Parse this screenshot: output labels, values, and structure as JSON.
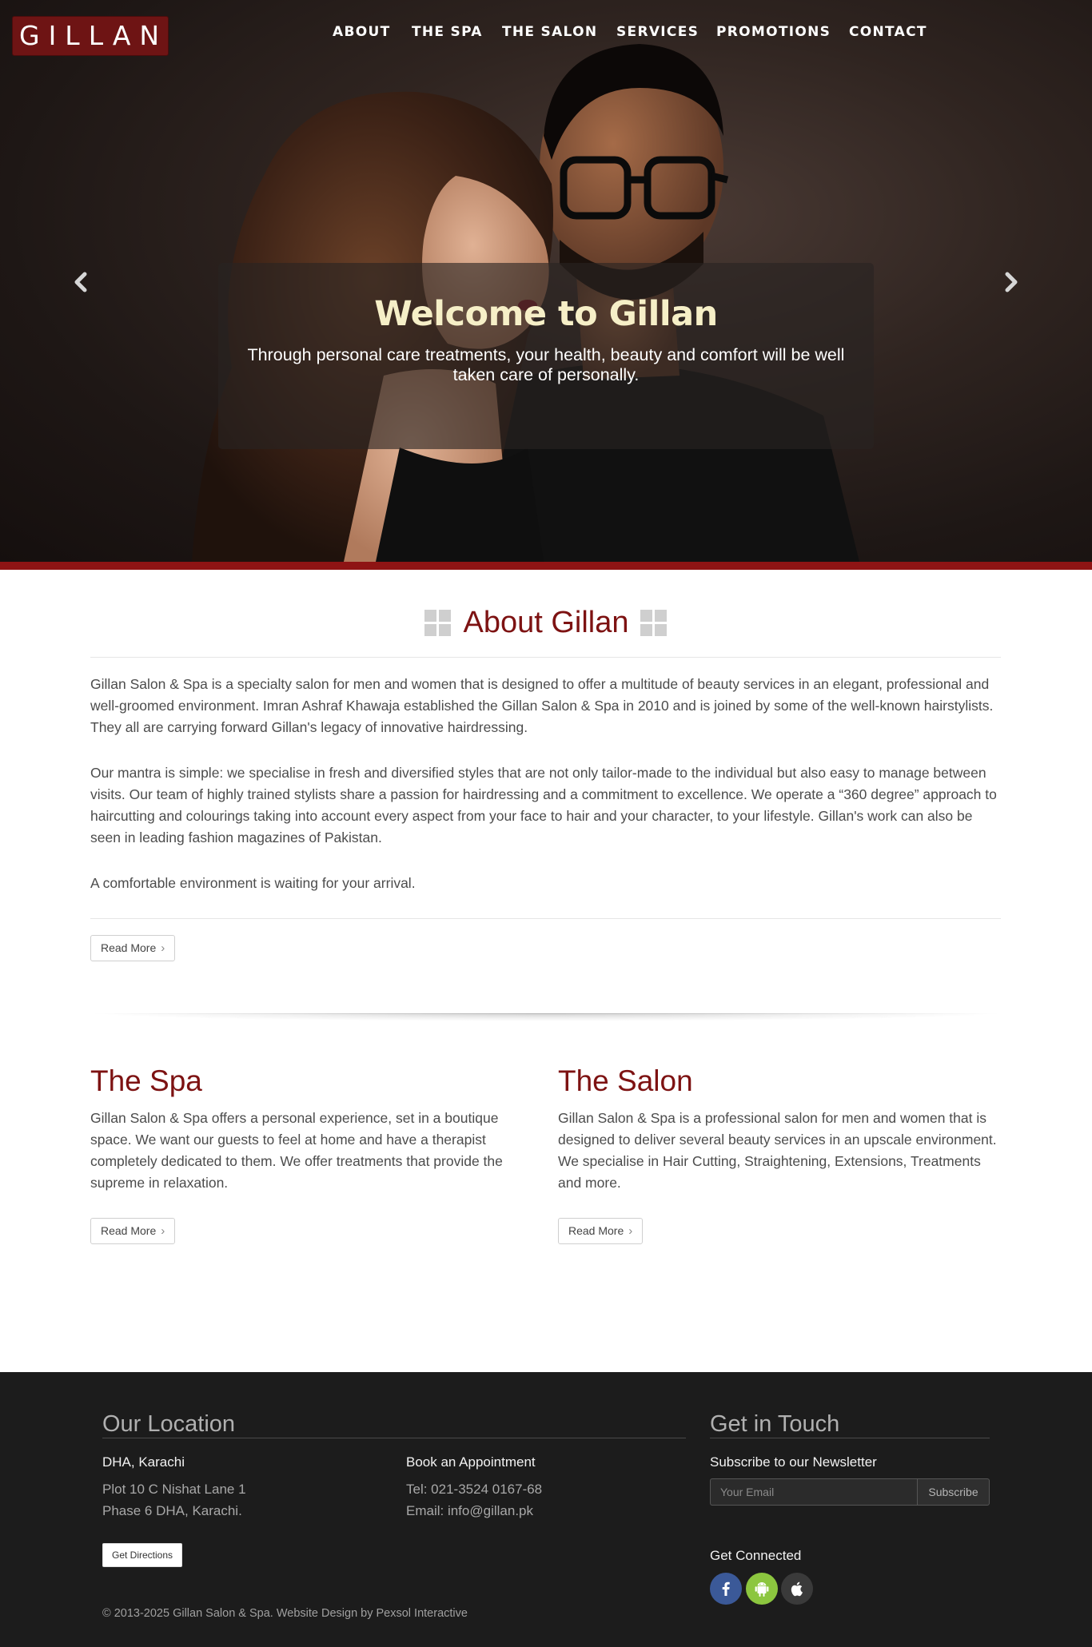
{
  "brand": {
    "logo_text": "GILLAN",
    "accent": "#7d1212",
    "hero_bar": "#8e1414"
  },
  "nav": {
    "items": [
      {
        "label": "ABOUT"
      },
      {
        "label": "THE SPA"
      },
      {
        "label": "THE SALON"
      },
      {
        "label": "SERVICES"
      },
      {
        "label": "PROMOTIONS"
      },
      {
        "label": "CONTACT"
      }
    ]
  },
  "hero": {
    "title": "Welcome to Gillan",
    "subtitle": "Through personal care treatments, your health, beauty and comfort will be well taken care of personally.",
    "prev_icon": "chevron-left-icon",
    "next_icon": "chevron-right-icon"
  },
  "about": {
    "title": "About Gillan",
    "paragraphs": [
      "Gillan Salon & Spa is a specialty salon for men and women that is designed to offer a multitude of beauty services in an elegant, professional and well-groomed environment. Imran Ashraf Khawaja established the Gillan Salon & Spa in 2010 and is joined by some of the well-known hairstylists. They all are carrying forward Gillan's legacy of innovative hairdressing.",
      "Our mantra is simple: we specialise in fresh and diversified styles that are not only tailor-made to the individual but also easy to manage between visits. Our team of highly trained stylists share a passion for hairdressing and a commitment to excellence. We operate a “360 degree” approach to haircutting and colourings taking into account every aspect from your face to hair and your character, to your lifestyle. Gillan's work can also be seen in leading fashion magazines of Pakistan.",
      "A comfortable environment is waiting for your arrival."
    ],
    "read_more": "Read More"
  },
  "spa": {
    "title": "The Spa",
    "text": "Gillan Salon & Spa offers a personal experience, set in a boutique space. We want our guests to feel at home and have a therapist completely dedicated to them. We offer treatments that provide the supreme in relaxation.",
    "read_more": "Read More"
  },
  "salon": {
    "title": "The Salon",
    "text": "Gillan Salon & Spa is a professional salon for men and women that is designed to deliver several beauty services in an upscale environment. We specialise in Hair Cutting, Straightening, Extensions, Treatments and more.",
    "read_more": "Read More"
  },
  "footer": {
    "location": {
      "heading": "Our Location",
      "area": "DHA, Karachi",
      "address_line1": "Plot 10 C Nishat Lane 1",
      "address_line2": "Phase 6 DHA, Karachi.",
      "directions_button": "Get Directions"
    },
    "appointment": {
      "heading": "Book an Appointment",
      "tel": "Tel: 021-3524 0167-68",
      "email": "Email: info@gillan.pk"
    },
    "touch": {
      "heading": "Get in Touch",
      "newsletter_label": "Subscribe to our Newsletter",
      "email_placeholder": "Your Email",
      "subscribe_button": "Subscribe",
      "connected_label": "Get Connected",
      "social": [
        {
          "icon": "facebook-icon",
          "color": "#3b5998"
        },
        {
          "icon": "android-icon",
          "color": "#8cc63f"
        },
        {
          "icon": "apple-icon",
          "color": "#3a3a3a"
        }
      ]
    },
    "copyright": "© 2013-2025 Gillan Salon & Spa. Website Design by Pexsol Interactive"
  }
}
